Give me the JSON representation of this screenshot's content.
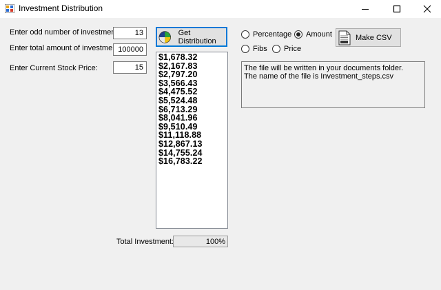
{
  "window": {
    "title": "Investment Distribution",
    "icon": "app-grid-icon"
  },
  "inputs": {
    "odd_investments_label": "Enter odd number of investments:",
    "odd_investments_value": "13",
    "total_amount_label": "Enter total amount of investment:",
    "total_amount_value": "100000",
    "stock_price_label": "Enter Current Stock Price:",
    "stock_price_value": "15"
  },
  "buttons": {
    "get_distribution": "Get Distribution",
    "make_csv": "Make CSV"
  },
  "distribution": [
    "$1,678.32",
    "$2,167.83",
    "$2,797.20",
    "$3,566.43",
    "$4,475.52",
    "$5,524.48",
    "$6,713.29",
    "$8,041.96",
    "$9,510.49",
    "$11,118.88",
    "$12,867.13",
    "$14,755.24",
    "$16,783.22"
  ],
  "options": {
    "percentage": "Percentage",
    "amount": "Amount",
    "fibs": "Fibs",
    "price": "Price",
    "selected": "amount"
  },
  "message": {
    "line1": "The file will be written in your documents folder.",
    "line2": "The name of the file is Investment_steps.csv"
  },
  "total": {
    "label": "Total Investment:",
    "value": "100%"
  }
}
